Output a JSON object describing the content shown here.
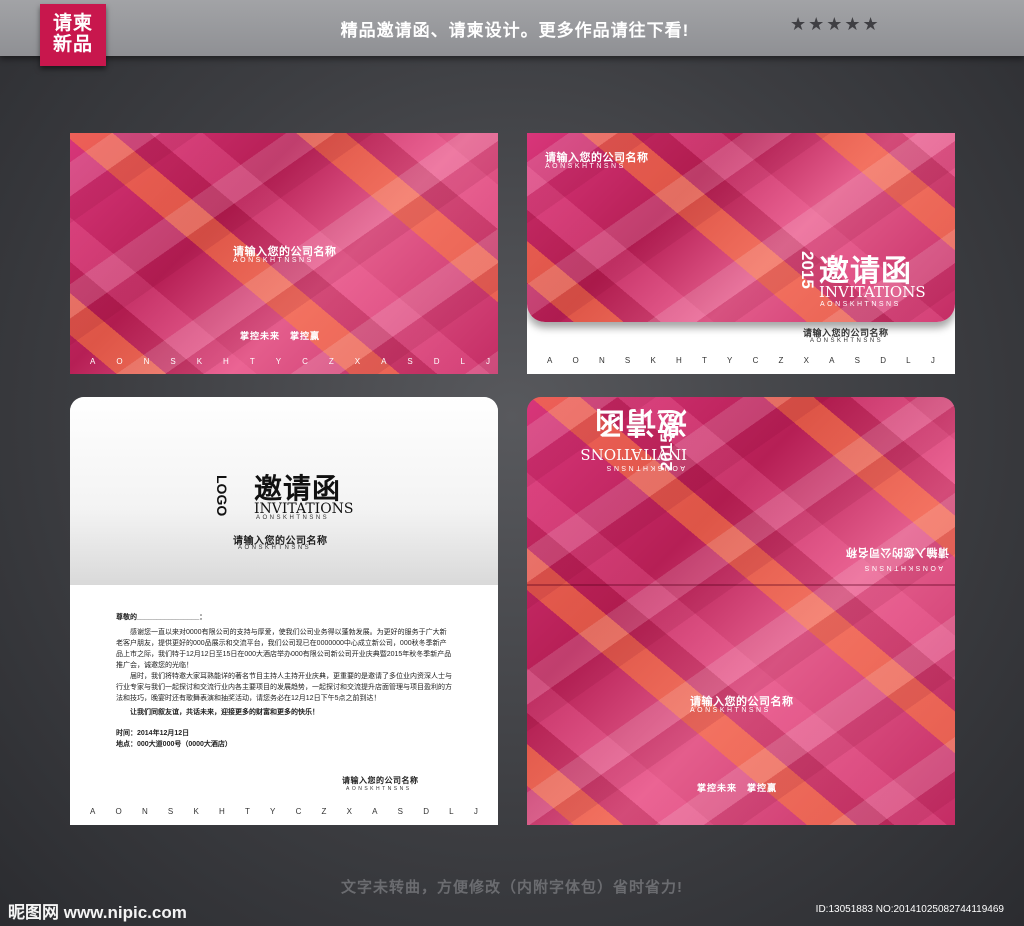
{
  "header": {
    "badge_line1": "请柬",
    "badge_line2": "新品",
    "tagline": "精品邀请函、请柬设计。更多作品请往下看!",
    "stars": "★★★★★"
  },
  "common": {
    "company_cn": "请输入您的公司名称",
    "company_en": "AONSKHTNSNS",
    "slogan": "掌控未来　掌控赢",
    "invite_cn": "邀请函",
    "invite_en": "INVITATIONS",
    "year": "2015",
    "logo": "LOGO",
    "alphabet": [
      "A",
      "O",
      "N",
      "S",
      "K",
      "H",
      "T",
      "Y",
      "C",
      "Z",
      "X",
      "A",
      "S",
      "D",
      "L",
      "J"
    ]
  },
  "letter": {
    "salutation": "尊敬的________________：",
    "para1": "感谢您一直以来对0000有限公司的支持与厚爱，使我们公司业务得以蓬勃发展。为更好的服务于广大新老客户朋友，提供更好的000品展示和交流平台，我们公司现已在0000000中心成立新公司，000秋冬季新产品上市之际，我们特于12月12日至15日在000大酒店举办000有限公司新公司开业庆典暨2015年秋冬季新产品推广会，诚邀您的光临！",
    "para2": "届时，我们将特邀大家耳熟能详的著名节目主持人主持开业庆典，更重要的是邀请了多位业内资深人士与行业专家与我们一起探讨和交流行业内各主要项目的发展趋势，一起探讨和交流提升店面管理与项目盈利的方法和技巧，晚宴时还有歌舞表演和抽奖活动，请您务必在12月12日下午5点之前到达！",
    "closing": "让我们同叙友谊，共话未来，迎接更多的财富和更多的快乐！",
    "time": "时间：2014年12月12日",
    "place": "地点：000大道000号（0000大酒店）"
  },
  "footer": {
    "note": "文字未转曲，方便修改（内附字体包）省时省力!",
    "watermark": "昵图网 www.nipic.com",
    "image_id": "ID:13051883 NO:20141025082744119469"
  }
}
